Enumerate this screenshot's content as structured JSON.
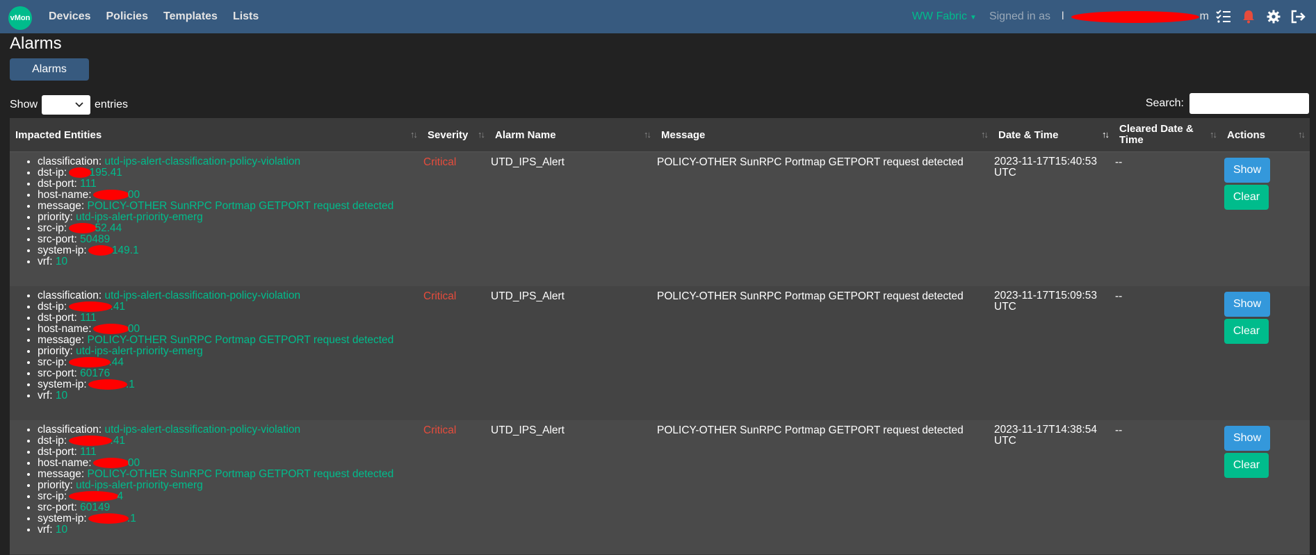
{
  "nav": {
    "logo": "vMon",
    "links": [
      "Devices",
      "Policies",
      "Templates",
      "Lists"
    ],
    "fabric": "WW Fabric",
    "signed_in_label": "Signed in as",
    "user_start": "l",
    "user_end": "m"
  },
  "page": {
    "title": "Alarms",
    "tab": "Alarms",
    "show_label": "Show",
    "entries_label": "entries",
    "search_label": "Search:"
  },
  "table": {
    "headers": [
      "Impacted Entities",
      "Severity",
      "Alarm Name",
      "Message",
      "Date & Time",
      "Cleared Date & Time",
      "Actions"
    ],
    "rows": [
      {
        "entities": {
          "classification": "utd-ips-alert-classification-policy-violation",
          "dst_ip": "195.41",
          "dst_port": "111",
          "host_name": "00",
          "message": "POLICY-OTHER SunRPC Portmap GETPORT request detected",
          "priority": "utd-ips-alert-priority-emerg",
          "src_ip": "52.44",
          "src_port": "50489",
          "system_ip": "149.1",
          "vrf": "10"
        },
        "severity": "Critical",
        "alarm_name": "UTD_IPS_Alert",
        "message": "POLICY-OTHER SunRPC Portmap GETPORT request detected",
        "datetime": "2023-11-17T15:40:53 UTC",
        "cleared": "--",
        "show": "Show",
        "clear": "Clear"
      },
      {
        "entities": {
          "classification": "utd-ips-alert-classification-policy-violation",
          "dst_ip": ".41",
          "dst_port": "111",
          "host_name": "00",
          "message": "POLICY-OTHER SunRPC Portmap GETPORT request detected",
          "priority": "utd-ips-alert-priority-emerg",
          "src_ip": ".44",
          "src_port": "60176",
          "system_ip": ".1",
          "vrf": "10"
        },
        "severity": "Critical",
        "alarm_name": "UTD_IPS_Alert",
        "message": "POLICY-OTHER SunRPC Portmap GETPORT request detected",
        "datetime": "2023-11-17T15:09:53 UTC",
        "cleared": "--",
        "show": "Show",
        "clear": "Clear"
      },
      {
        "entities": {
          "classification": "utd-ips-alert-classification-policy-violation",
          "dst_ip": ".41",
          "dst_port": "111",
          "host_name": "00",
          "message": "POLICY-OTHER SunRPC Portmap GETPORT request detected",
          "priority": "utd-ips-alert-priority-emerg",
          "src_ip": "4",
          "src_port": "60149",
          "system_ip": ".1",
          "vrf": "10"
        },
        "severity": "Critical",
        "alarm_name": "UTD_IPS_Alert",
        "message": "POLICY-OTHER SunRPC Portmap GETPORT request detected",
        "datetime": "2023-11-17T14:38:54 UTC",
        "cleared": "--",
        "show": "Show",
        "clear": "Clear"
      }
    ]
  },
  "labels": {
    "classification": "classification: ",
    "dst_ip": "dst-ip: ",
    "dst_port": "dst-port: ",
    "host_name": "host-name: ",
    "message": "message: ",
    "priority": "priority: ",
    "src_ip": "src-ip: ",
    "src_port": "src-port: ",
    "system_ip": "system-ip: ",
    "vrf": "vrf: "
  },
  "colors": {
    "navbar": "#375a7f",
    "accent": "#00bc8c",
    "critical": "#e74c3c",
    "show_button": "#3498db"
  },
  "icons": [
    "tasks-icon",
    "bell-icon",
    "gear-icon",
    "sign-out-icon",
    "chevron-down-icon",
    "sort-icon"
  ]
}
